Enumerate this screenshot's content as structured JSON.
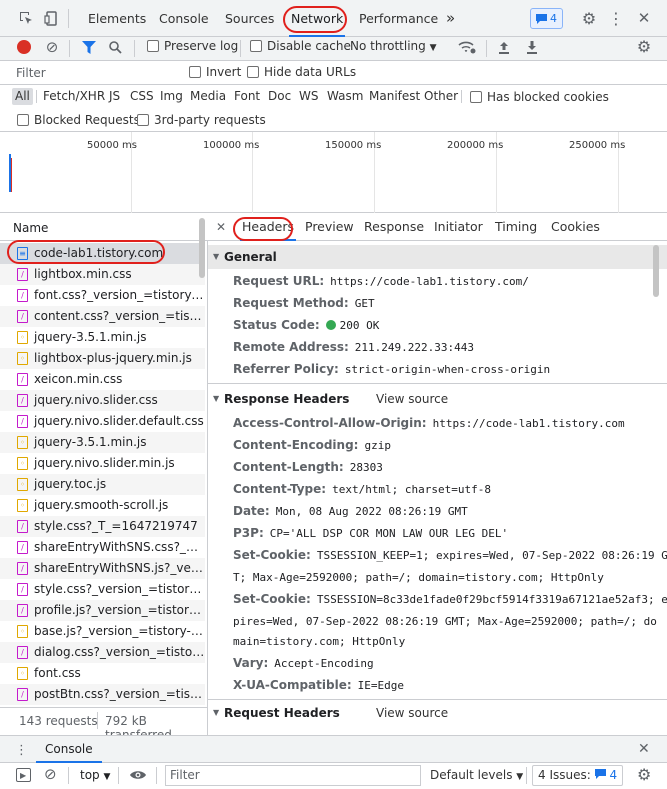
{
  "top_tabs": [
    {
      "label": "Elements"
    },
    {
      "label": "Console"
    },
    {
      "label": "Sources"
    },
    {
      "label": "Network"
    },
    {
      "label": "Performance"
    }
  ],
  "more_tabs": "»",
  "issues_badge": "4",
  "toolbar": {
    "preserve_log": "Preserve log",
    "disable_cache": "Disable cache",
    "throttling": "No throttling"
  },
  "filter": {
    "placeholder": "Filter",
    "invert": "Invert",
    "hide_data_urls": "Hide data URLs"
  },
  "types": [
    "All",
    "Fetch/XHR",
    "JS",
    "CSS",
    "Img",
    "Media",
    "Font",
    "Doc",
    "WS",
    "Wasm",
    "Manifest",
    "Other"
  ],
  "blocked_cookies": "Has blocked cookies",
  "blocked_requests": "Blocked Requests",
  "third_party": "3rd-party requests",
  "timeline_ticks": [
    "50000 ms",
    "100000 ms",
    "150000 ms",
    "200000 ms",
    "250000 ms"
  ],
  "name_header": "Name",
  "requests": [
    {
      "name": "code-lab1.tistory.com",
      "type": "doc"
    },
    {
      "name": "lightbox.min.css",
      "type": "css"
    },
    {
      "name": "font.css?_version_=tistory-e57",
      "type": "css"
    },
    {
      "name": "content.css?_version_=tistory-...",
      "type": "css"
    },
    {
      "name": "jquery-3.5.1.min.js",
      "type": "js"
    },
    {
      "name": "lightbox-plus-jquery.min.js",
      "type": "js"
    },
    {
      "name": "xeicon.min.css",
      "type": "css"
    },
    {
      "name": "jquery.nivo.slider.css",
      "type": "css"
    },
    {
      "name": "jquery.nivo.slider.default.css",
      "type": "css"
    },
    {
      "name": "jquery-3.5.1.min.js",
      "type": "js"
    },
    {
      "name": "jquery.nivo.slider.min.js",
      "type": "js"
    },
    {
      "name": "jquery.toc.js",
      "type": "js"
    },
    {
      "name": "jquery.smooth-scroll.js",
      "type": "js"
    },
    {
      "name": "style.css?_T_=1647219747",
      "type": "css"
    },
    {
      "name": "shareEntryWithSNS.css?_versi...",
      "type": "css"
    },
    {
      "name": "shareEntryWithSNS.js?_versio...",
      "type": "css"
    },
    {
      "name": "style.css?_version_=tistory-e5...",
      "type": "css"
    },
    {
      "name": "profile.js?_version_=tistory-e5...",
      "type": "css"
    },
    {
      "name": "base.js?_version_=tistory-e57...",
      "type": "js"
    },
    {
      "name": "dialog.css?_version_=tistory-e...",
      "type": "css"
    },
    {
      "name": "font.css",
      "type": "js"
    },
    {
      "name": "postBtn.css?_version_=tistory-...",
      "type": "css"
    }
  ],
  "status": {
    "requests": "143 requests",
    "transferred": "792 kB transferred"
  },
  "detail_tabs": [
    "Headers",
    "Preview",
    "Response",
    "Initiator",
    "Timing",
    "Cookies"
  ],
  "general": {
    "title": "General",
    "url_k": "Request URL:",
    "url_v": "https://code-lab1.tistory.com/",
    "method_k": "Request Method:",
    "method_v": "GET",
    "status_k": "Status Code:",
    "status_v": "200 OK",
    "addr_k": "Remote Address:",
    "addr_v": "211.249.222.33:443",
    "ref_k": "Referrer Policy:",
    "ref_v": "strict-origin-when-cross-origin"
  },
  "response_headers": {
    "title": "Response Headers",
    "view_source": "View source",
    "items": [
      {
        "k": "Access-Control-Allow-Origin:",
        "v": "https://code-lab1.tistory.com"
      },
      {
        "k": "Content-Encoding:",
        "v": "gzip"
      },
      {
        "k": "Content-Length:",
        "v": "28303"
      },
      {
        "k": "Content-Type:",
        "v": "text/html; charset=utf-8"
      },
      {
        "k": "Date:",
        "v": "Mon, 08 Aug 2022 08:26:19 GMT"
      },
      {
        "k": "P3P:",
        "v": "CP='ALL DSP COR MON LAW OUR LEG DEL'"
      }
    ],
    "cookie1_k": "Set-Cookie:",
    "cookie1_l1": "TSSESSION_KEEP=1; expires=Wed, 07-Sep-2022 08:26:19 GM",
    "cookie1_l2": "T; Max-Age=2592000; path=/; domain=tistory.com; HttpOnly",
    "cookie2_k": "Set-Cookie:",
    "cookie2_l1": "TSSESSION=8c33de1fade0f29bcf5914f3319a67121ae52af3; ex",
    "cookie2_l2": "pires=Wed, 07-Sep-2022 08:26:19 GMT; Max-Age=2592000; path=/; do",
    "cookie2_l3": "main=tistory.com; HttpOnly",
    "vary_k": "Vary:",
    "vary_v": "Accept-Encoding",
    "xua_k": "X-UA-Compatible:",
    "xua_v": "IE=Edge"
  },
  "request_headers": {
    "title": "Request Headers",
    "view_source": "View source"
  },
  "drawer": {
    "title": "Console"
  },
  "console": {
    "context": "top",
    "filter_placeholder": "Filter",
    "levels": "Default levels",
    "issues": "4 Issues:",
    "issues_count": "4"
  },
  "colors": {
    "accent": "#1a73e8",
    "record": "#d93025",
    "ok": "#34a853",
    "annotation": "#e0201c"
  }
}
